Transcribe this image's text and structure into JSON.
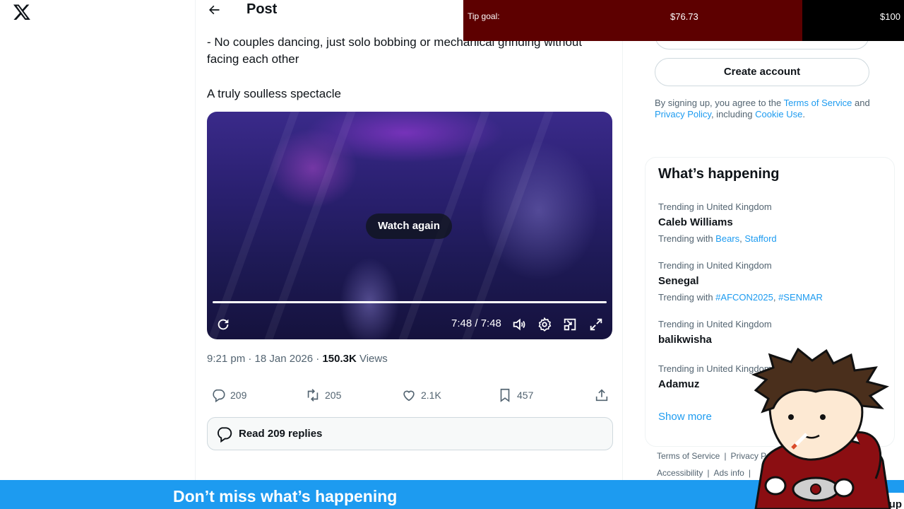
{
  "nav": {
    "logo_icon": "x-logo-icon"
  },
  "header": {
    "back_icon": "arrow-left-icon",
    "title": "Post"
  },
  "tweet": {
    "text_line1": "- No couples dancing, just solo bobbing or mechanical grinding without facing each other",
    "text_line2": "A truly soulless spectacle",
    "timestamp": "9:21 pm · 18 Jan 2026 · ",
    "views_count": "150.3K",
    "views_label": " Views"
  },
  "video": {
    "overlay_label": "Watch again",
    "time": "7:48 / 7:48",
    "progress": 1.0,
    "icons": [
      "replay-icon",
      "volume-icon",
      "settings-icon",
      "pip-icon",
      "fullscreen-icon"
    ]
  },
  "actions": {
    "replies": "209",
    "reposts": "205",
    "likes": "2.1K",
    "bookmarks": "457"
  },
  "read_replies": {
    "label": "Read 209 replies"
  },
  "signup": {
    "create_account": "Create account",
    "legal_prefix": "By signing up, you agree to the ",
    "terms_link": "Terms of Service",
    "legal_and": " and ",
    "privacy_link": "Privacy Policy",
    "legal_including": ", including ",
    "cookie_link": "Cookie Use",
    "legal_end": "."
  },
  "trends": {
    "title": "What’s happening",
    "items": [
      {
        "context": "Trending in United Kingdom",
        "name": "Caleb Williams",
        "with_label": "Trending with ",
        "tags": [
          "Bears",
          "Stafford"
        ]
      },
      {
        "context": "Trending in United Kingdom",
        "name": "Senegal",
        "with_label": "Trending with ",
        "tags": [
          "#AFCON2025",
          "#SENMAR"
        ]
      },
      {
        "context": "Trending in United Kingdom",
        "name": "balikwisha"
      },
      {
        "context": "Trending in United Kingdom",
        "name": "Adamuz"
      }
    ],
    "show_more": "Show more"
  },
  "footer": {
    "terms": "Terms of Service",
    "privacy": "Privacy P",
    "accessibility": "Accessibility",
    "ads_info": "Ads info",
    "separator": "|"
  },
  "tip_goal": {
    "label": "Tip goal:",
    "current": "$76.73",
    "target": "$100",
    "progress_fraction": 0.77,
    "fill_color": "#5d0000"
  },
  "banner": {
    "text": "Don’t miss what’s happening",
    "signup": "Sign up",
    "color": "#1d9bf0"
  },
  "colors": {
    "accent": "#1d9bf0",
    "text": "#0f1419",
    "muted": "#536471"
  }
}
